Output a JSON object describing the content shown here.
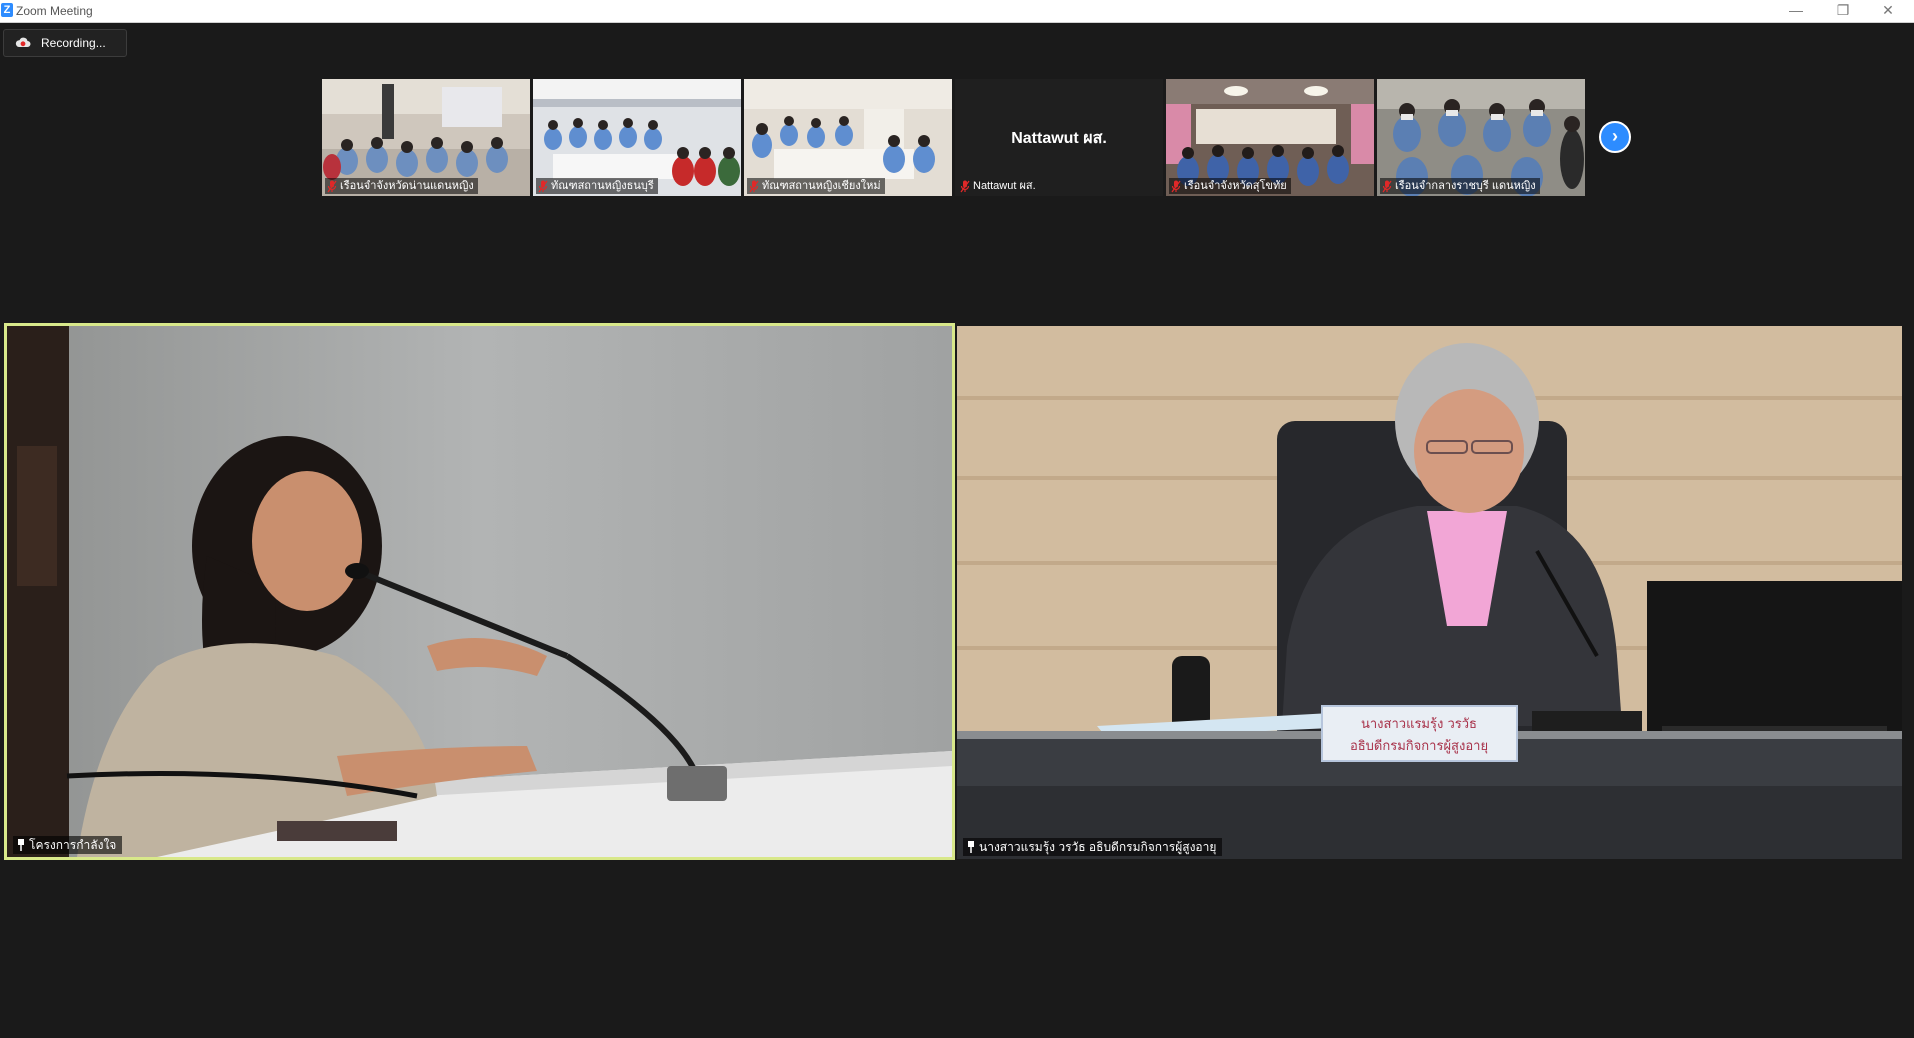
{
  "window": {
    "title": "Zoom Meeting",
    "controls": {
      "minimize": "—",
      "restore": "❐",
      "close": "✕"
    },
    "logo_icon": "zoom-logo-icon"
  },
  "recording": {
    "label": "Recording...",
    "icon": "cloud-record-icon"
  },
  "thumbnails": [
    {
      "name": "เรือนจำจังหวัดน่านแดนหญิง",
      "muted": true
    },
    {
      "name": "ทัณฑสถานหญิงธนบุรี",
      "muted": true
    },
    {
      "name": "ทัณฑสถานหญิงเชียงใหม่",
      "muted": true
    },
    {
      "name": "Nattawut ผส.",
      "display_name": "Nattawut ผส.",
      "muted": true,
      "video": false
    },
    {
      "name": "เรือนจำจังหวัดสุโขทัย",
      "muted": true
    },
    {
      "name": "เรือนจำกลางราชบุรี แดนหญิง",
      "muted": true
    }
  ],
  "strip_next": {
    "label": "›",
    "icon": "chevron-right-icon"
  },
  "main_tiles": {
    "left": {
      "name": "โครงการกำลังใจ",
      "pinned": true,
      "active_speaker": true
    },
    "right": {
      "name": "นางสาวแรมรุ้ง วรวัธ อธิบดีกรมกิจการผู้สูงอายุ",
      "pinned": true,
      "nameplate_line1": "นางสาวแรมรุ้ง วรวัธ",
      "nameplate_line2": "อธิบดีกรมกิจการผู้สูงอายุ"
    }
  },
  "colors": {
    "background": "#1a1a1a",
    "accent": "#2d8cff",
    "active_speaker_border": "#d8e88a",
    "muted_red": "#e02828"
  }
}
